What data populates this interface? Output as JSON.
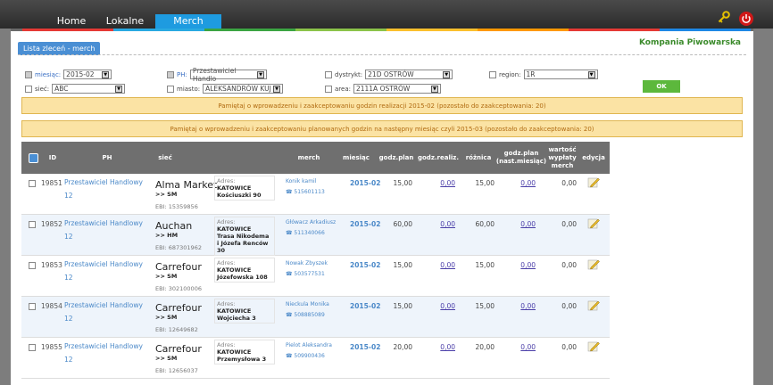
{
  "nav": {
    "tabs": [
      {
        "label": "Home"
      },
      {
        "label": "Lokalne"
      },
      {
        "label": "Merch",
        "active": true
      }
    ],
    "strip_colors": [
      "#e53935",
      "#29a9e1",
      "#3ba543",
      "#8bc34a",
      "#fbc02d",
      "#ff9800",
      "#e53935",
      "#1e88e5"
    ],
    "icons": [
      "key-icon",
      "power-icon"
    ]
  },
  "header": {
    "tab_label": "Lista zleceń - merch",
    "company": "Kompania Piwowarska"
  },
  "filters": {
    "miesiac": {
      "label": "miesiąc:",
      "value": "2015-02"
    },
    "ph": {
      "label": "PH:",
      "value": "Przestawiciel Handlo"
    },
    "dystrykt": {
      "label": "dystrykt:",
      "value": "21D OSTRÓW"
    },
    "region": {
      "label": "region:",
      "value": "1R"
    },
    "siec": {
      "label": "sieć:",
      "value": "ABC"
    },
    "miasto": {
      "label": "miasto:",
      "value": "ALEKSANDRÓW KUJ"
    },
    "area": {
      "label": "area:",
      "value": "2111A OSTRÓW"
    },
    "ok_label": "OK"
  },
  "notices": {
    "n1": "Pamiętaj o wprowadzeniu i zaakceptowaniu godzin realizacji 2015-02 (pozostało do zaakceptowania: 20)",
    "n2": "Pamiętaj o wprowadzeniu i zaakceptowaniu planowanych godzin na następny miesiąc czyli 2015-03 (pozostało do zaakceptowania: 20)"
  },
  "table": {
    "headers": {
      "id": "ID",
      "ph": "PH",
      "siec": "sieć",
      "merch": "merch",
      "miesiac": "miesiąc",
      "godz_plan": "godz.plan",
      "godz_realiz": "godz.realiz.",
      "roznica": "różnica",
      "godz_plan_next": "godz.plan (nast.miesiąc)",
      "wartosc": "wartość wypłaty merch",
      "edycja": "edycja"
    },
    "rows": [
      {
        "id": "19851",
        "ph": "Przestawiciel Handlowy 12",
        "shop": "Alma Market",
        "shop_type": ">> SM",
        "ebi": "EBI: 15359856",
        "addr_label": "Adres:",
        "city": "KATOWICE",
        "street": "Kościuszki 90",
        "merch": "Konik kamil",
        "tel": "515601113",
        "miesiac": "2015-02",
        "plan": "15,00",
        "realiz": "0,00",
        "roznica": "15,00",
        "plan_next": "0,00",
        "wartosc": "0,00"
      },
      {
        "id": "19852",
        "ph": "Przestawiciel Handlowy 12",
        "shop": "Auchan",
        "shop_type": ">> HM",
        "ebi": "EBI: 687301962",
        "addr_label": "Adres:",
        "city": "KATOWICE",
        "street": "Trasa Nikodema i Józefa Renców 30",
        "merch": "Główacz Arkadiusz",
        "tel": "511340066",
        "miesiac": "2015-02",
        "plan": "60,00",
        "realiz": "0,00",
        "roznica": "60,00",
        "plan_next": "0,00",
        "wartosc": "0,00"
      },
      {
        "id": "19853",
        "ph": "Przestawiciel Handlowy 12",
        "shop": "Carrefour",
        "shop_type": ">> SM",
        "ebi": "EBI: 302100006",
        "addr_label": "Adres:",
        "city": "KATOWICE",
        "street": "Józefowska 108",
        "merch": "Nowak Zbyszek",
        "tel": "503577531",
        "miesiac": "2015-02",
        "plan": "15,00",
        "realiz": "0,00",
        "roznica": "15,00",
        "plan_next": "0,00",
        "wartosc": "0,00"
      },
      {
        "id": "19854",
        "ph": "Przestawiciel Handlowy 12",
        "shop": "Carrefour",
        "shop_type": ">> SM",
        "ebi": "EBI: 12649682",
        "addr_label": "Adres:",
        "city": "KATOWICE",
        "street": "Wojciecha 3",
        "merch": "Nieckula Monika",
        "tel": "508885089",
        "miesiac": "2015-02",
        "plan": "15,00",
        "realiz": "0,00",
        "roznica": "15,00",
        "plan_next": "0,00",
        "wartosc": "0,00"
      },
      {
        "id": "19855",
        "ph": "Przestawiciel Handlowy 12",
        "shop": "Carrefour",
        "shop_type": ">> SM",
        "ebi": "EBI: 12656037",
        "addr_label": "Adres:",
        "city": "KATOWICE",
        "street": "Przemysłowa 3",
        "merch": "Pielot Aleksandra",
        "tel": "509900436",
        "miesiac": "2015-02",
        "plan": "20,00",
        "realiz": "0,00",
        "roznica": "20,00",
        "plan_next": "0,00",
        "wartosc": "0,00"
      }
    ]
  }
}
